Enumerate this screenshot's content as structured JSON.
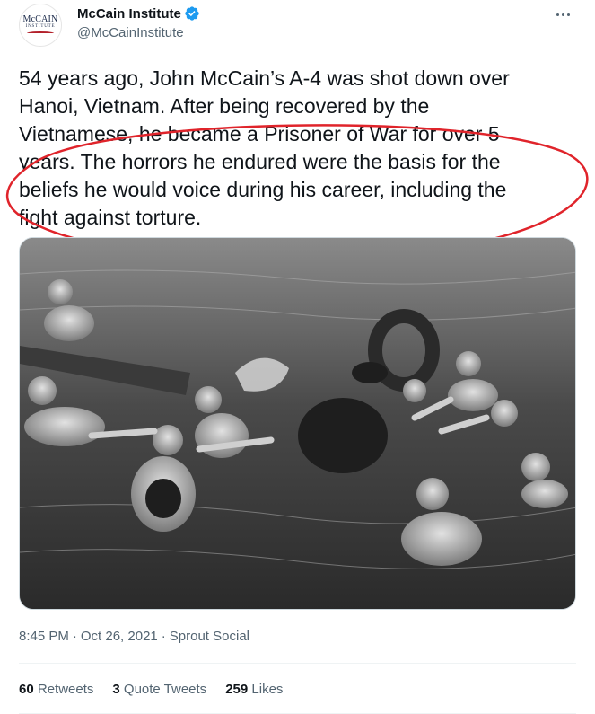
{
  "account": {
    "avatar_logo_main": "McCAIN",
    "avatar_logo_sub": "INSTITUTE",
    "display_name": "McCain Institute",
    "handle": "@McCainInstitute",
    "verified_icon": "verified-badge-icon",
    "more_icon": "more-options-icon"
  },
  "tweet": {
    "text": "54 years ago, John McCain’s A-4 was shot down over\nHanoi, Vietnam. After being recovered by the\nVietnamese, he became a Prisoner of War for over 5\nyears. The horrors he endured were the basis for the\nbeliefs he would voice during his career, including the\nfight against torture.",
    "annotation_color": "#e0242b",
    "photo_desc_icon": "black-and-white-photo"
  },
  "meta": {
    "time": "8:45 PM",
    "date": "Oct 26, 2021",
    "source": "Sprout Social",
    "separator": "·"
  },
  "stats": {
    "retweets_count": "60",
    "retweets_label": "Retweets",
    "quote_count": "3",
    "quote_label": "Quote Tweets",
    "likes_count": "259",
    "likes_label": "Likes"
  },
  "colors": {
    "text_primary": "#0f1419",
    "text_secondary": "#536471",
    "verified_blue": "#1d9bf0",
    "divider": "#eff3f4"
  }
}
